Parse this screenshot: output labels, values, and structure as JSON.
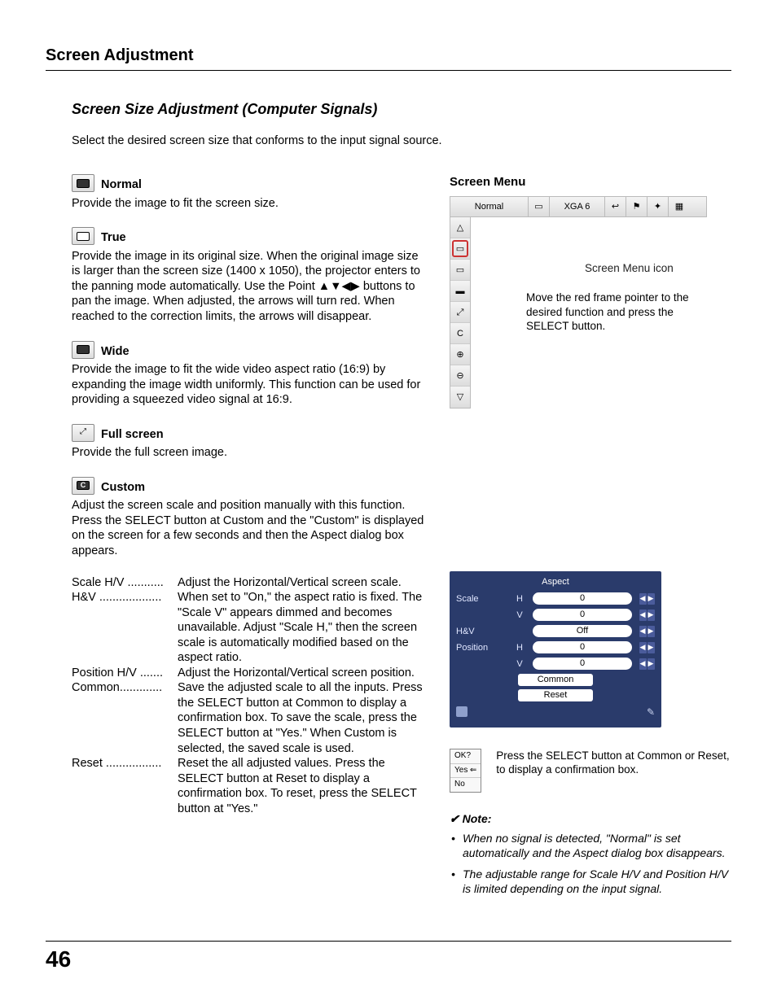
{
  "header": {
    "title": "Screen Adjustment"
  },
  "section": {
    "title": "Screen Size Adjustment (Computer Signals)",
    "intro": "Select the desired screen size that conforms to the input signal source."
  },
  "items": {
    "normal": {
      "label": "Normal",
      "desc": "Provide the image to fit the screen size."
    },
    "true_": {
      "label": "True",
      "desc": "Provide the image in its original size. When the original image size is larger than the screen size (1400 x 1050), the projector enters to the panning mode automatically. Use the Point ▲▼◀▶ buttons to pan the image. When adjusted, the arrows will turn red. When reached to the correction limits, the arrows will disappear."
    },
    "wide": {
      "label": "Wide",
      "desc": "Provide the image to fit the wide video aspect ratio (16:9) by expanding the image width uniformly. This function can be used for providing a squeezed video signal at 16:9."
    },
    "full": {
      "label": "Full screen",
      "desc": "Provide the full screen image."
    },
    "custom": {
      "label": "Custom",
      "desc1": "Adjust the screen scale and position manually with this function.",
      "desc2": "Press the SELECT button at Custom and the \"Custom\" is displayed on the screen for a few seconds and then the Aspect dialog box appears."
    }
  },
  "defs": {
    "scale": {
      "term": "Scale H/V ...........",
      "body": "Adjust the Horizontal/Vertical screen scale."
    },
    "hv": {
      "term": "H&V ...................",
      "body": "When set to \"On,\" the aspect ratio is fixed. The \"Scale V\" appears dimmed and becomes unavailable. Adjust \"Scale H,\" then the screen scale is automatically modified based on the aspect ratio."
    },
    "pos": {
      "term": "Position H/V .......",
      "body": "Adjust the Horizontal/Vertical screen position."
    },
    "common": {
      "term": "Common.............",
      "body": "Save the adjusted scale to all the inputs. Press the SELECT button at Common to display a confirmation box. To save the scale, press the SELECT button at \"Yes.\" When Custom is selected, the saved scale is used."
    },
    "reset": {
      "term": "Reset .................",
      "body": "Reset the all adjusted values. Press the SELECT button at Reset to display a confirmation box. To reset, press the SELECT button at \"Yes.\""
    }
  },
  "right": {
    "menu_title": "Screen Menu",
    "top_label": "Normal",
    "top_mid": "XGA 6",
    "callout1": "Screen Menu icon",
    "callout2": "Move the red frame pointer to the desired function and press the SELECT button."
  },
  "aspect": {
    "title": "Aspect",
    "scale_label": "Scale",
    "hv_label": "H&V",
    "pos_label": "Position",
    "h": "H",
    "v": "V",
    "scale_h": "0",
    "scale_v": "0",
    "hv_val": "Off",
    "pos_h": "0",
    "pos_v": "0",
    "common_btn": "Common",
    "reset_btn": "Reset"
  },
  "okbox": {
    "ok": "OK?",
    "yes": "Yes",
    "no": "No",
    "caption": "Press the SELECT button at Common or Reset, to display a confirmation box."
  },
  "note": {
    "heading": "✔ Note:",
    "n1": "When no signal is detected, \"Normal\" is set automatically and the Aspect dialog box disappears.",
    "n2": "The adjustable range for Scale H/V and Position H/V is limited depending on the input signal."
  },
  "page_number": "46"
}
